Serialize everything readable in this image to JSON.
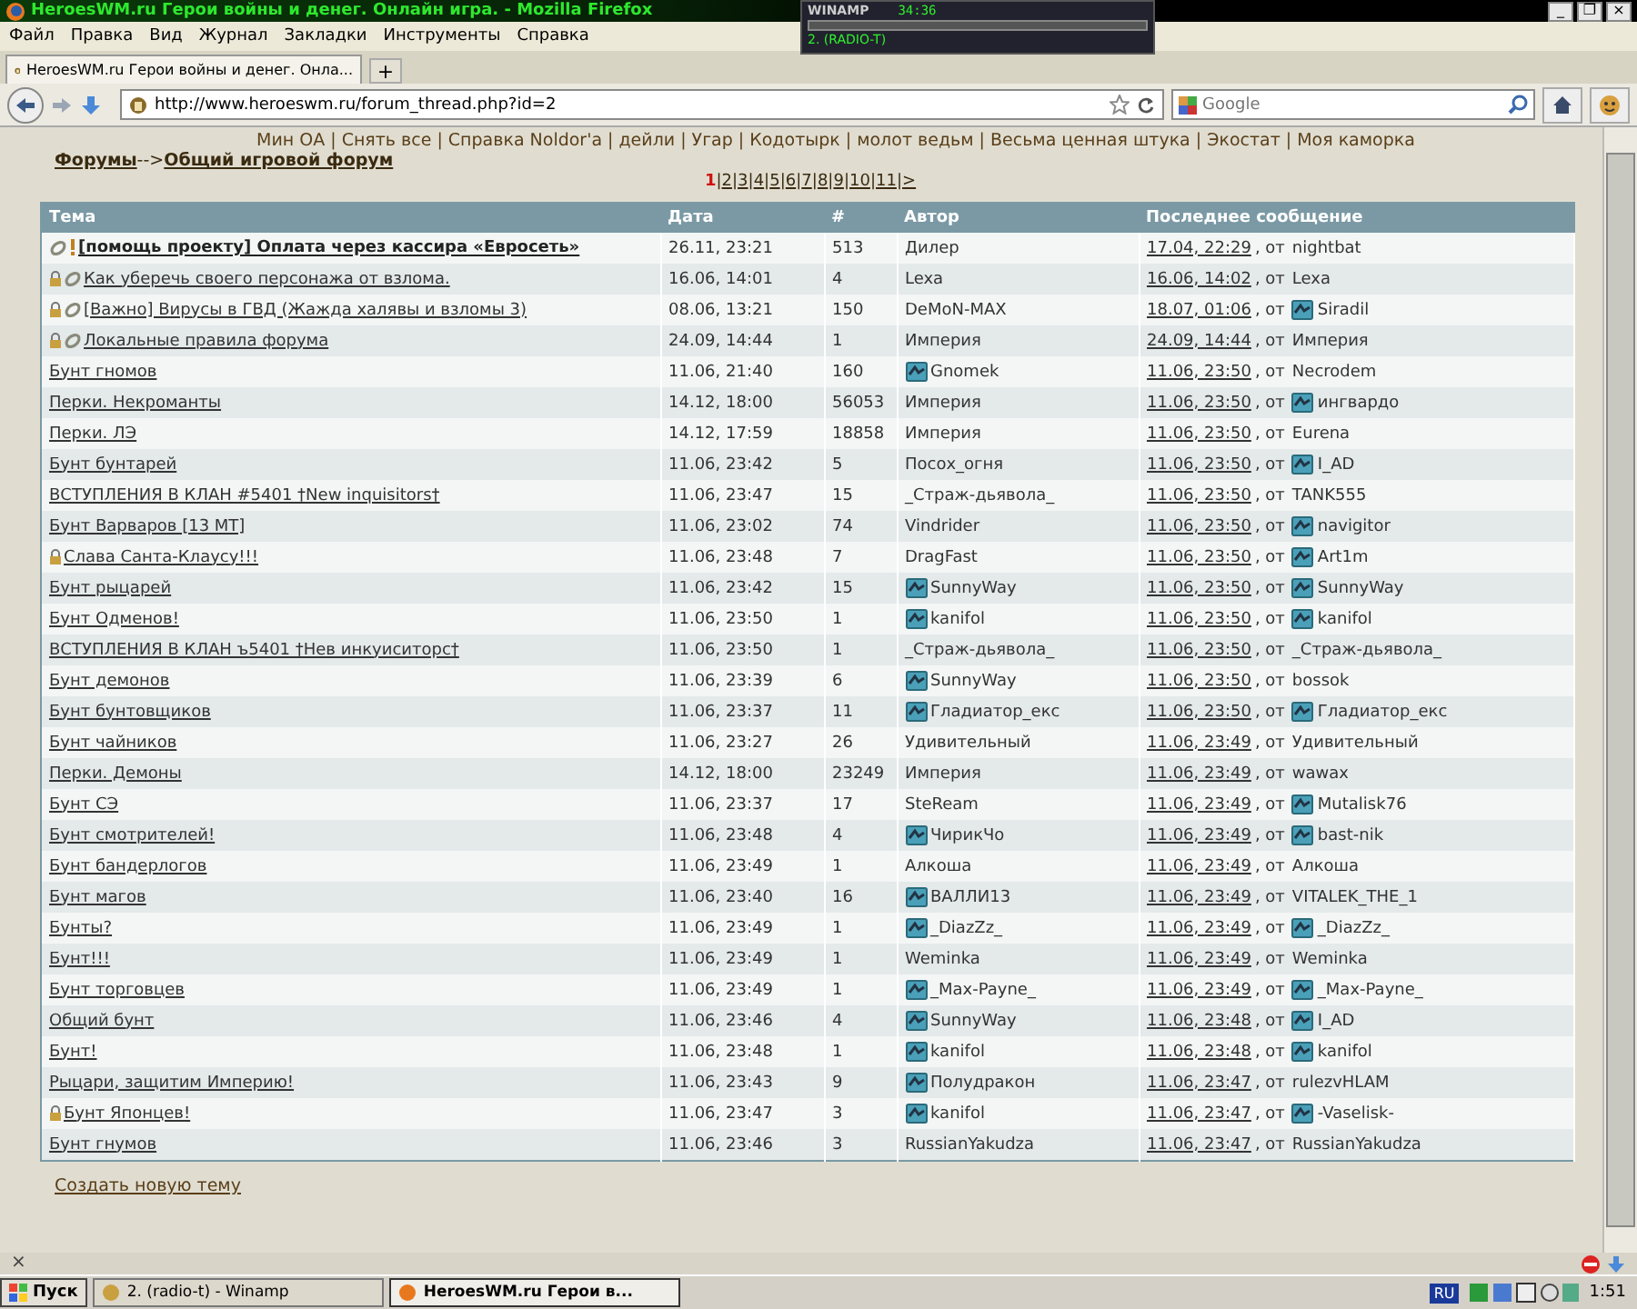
{
  "window": {
    "title": "HeroesWM.ru Герои войны и денег. Онлайн игра. - Mozilla Firefox",
    "controls": [
      "_",
      "❐",
      "×"
    ]
  },
  "winamp": {
    "title": "WINAMP",
    "time": "34:36",
    "track": "2. (RADIO-T)"
  },
  "menu": [
    "Файл",
    "Правка",
    "Вид",
    "Журнал",
    "Закладки",
    "Инструменты",
    "Справка"
  ],
  "tabs": [
    {
      "label": "HeroesWM.ru Герои войны и денег. Онла...",
      "selected": true
    }
  ],
  "new_tab": "+",
  "address": {
    "url": "http://www.heroeswm.ru/forum_thread.php?id=2"
  },
  "search": {
    "placeholder": "Google"
  },
  "top_links": [
    "Мин ОА",
    "Снять все",
    "Справка Noldor'a",
    "дейли",
    "Угар",
    "Кодотырк",
    "молот ведьм",
    "Весьма ценная штука",
    "Экостат",
    "Моя каморка"
  ],
  "link_separator": "|",
  "breadcrumb": {
    "root": "Форумы",
    "arrow": "-->",
    "current": "Общий игровой форум"
  },
  "pages": [
    {
      "label": "1",
      "selected": true
    },
    {
      "label": "2",
      "selected": false
    },
    {
      "label": "3",
      "selected": false
    },
    {
      "label": "4",
      "selected": false
    },
    {
      "label": "5",
      "selected": false
    },
    {
      "label": "6",
      "selected": false
    },
    {
      "label": "7",
      "selected": false
    },
    {
      "label": "8",
      "selected": false
    },
    {
      "label": "9",
      "selected": false
    },
    {
      "label": "10",
      "selected": false
    },
    {
      "label": "11",
      "selected": false
    },
    {
      "label": ">",
      "selected": false
    }
  ],
  "page_separator": "|",
  "table": {
    "columns": [
      "Тема",
      "Дата",
      "#",
      "Автор",
      "Последнее сообщение"
    ],
    "rows": [
      {
        "topic": "[помощь проекту] Оплата через кассира «Евросеть»",
        "locked": false,
        "pinned": true,
        "important": true,
        "date": "26.11, 23:21",
        "count": "513",
        "author": "Дилер",
        "author_emblem": false,
        "last_date": "17.04, 22:29",
        "by": ", от",
        "last_user": "nightbat",
        "last_emblem": false
      },
      {
        "topic": "Как уберечь своего персонажа от взлома.",
        "locked": true,
        "pinned": true,
        "important": false,
        "date": "16.06, 14:01",
        "count": "4",
        "author": "Lexa",
        "author_emblem": false,
        "last_date": "16.06, 14:02",
        "by": ", от",
        "last_user": "Lexa",
        "last_emblem": false
      },
      {
        "topic": "[Важно] Вирусы в ГВД (Жажда халявы и взломы 3)",
        "locked": true,
        "pinned": true,
        "important": false,
        "date": "08.06, 13:21",
        "count": "150",
        "author": "DeMoN-MAX",
        "author_emblem": false,
        "last_date": "18.07, 01:06",
        "by": ", от",
        "last_user": "Siradil",
        "last_emblem": true
      },
      {
        "topic": "Локальные правила форума",
        "locked": true,
        "pinned": true,
        "important": false,
        "date": "24.09, 14:44",
        "count": "1",
        "author": "Империя",
        "author_emblem": false,
        "last_date": "24.09, 14:44",
        "by": ", от",
        "last_user": "Империя",
        "last_emblem": false
      },
      {
        "topic": "Бунт гномов",
        "locked": false,
        "pinned": false,
        "important": false,
        "date": "11.06, 21:40",
        "count": "160",
        "author": "Gnomek",
        "author_emblem": true,
        "last_date": "11.06, 23:50",
        "by": ", от",
        "last_user": "Necrodem",
        "last_emblem": false
      },
      {
        "topic": "Перки. Некроманты",
        "locked": false,
        "pinned": false,
        "important": false,
        "date": "14.12, 18:00",
        "count": "56053",
        "author": "Империя",
        "author_emblem": false,
        "last_date": "11.06, 23:50",
        "by": ", от",
        "last_user": "ингвардо",
        "last_emblem": true
      },
      {
        "topic": "Перки. ЛЭ",
        "locked": false,
        "pinned": false,
        "important": false,
        "date": "14.12, 17:59",
        "count": "18858",
        "author": "Империя",
        "author_emblem": false,
        "last_date": "11.06, 23:50",
        "by": ", от",
        "last_user": "Eurena",
        "last_emblem": false
      },
      {
        "topic": "Бунт бунтарей",
        "locked": false,
        "pinned": false,
        "important": false,
        "date": "11.06, 23:42",
        "count": "5",
        "author": "Посох_огня",
        "author_emblem": false,
        "last_date": "11.06, 23:50",
        "by": ", от",
        "last_user": "I_AD",
        "last_emblem": true
      },
      {
        "topic": "ВСТУПЛЕНИЯ В КЛАН #5401 †New inquisitors†",
        "locked": false,
        "pinned": false,
        "important": false,
        "date": "11.06, 23:47",
        "count": "15",
        "author": "_Страж-дьявола_",
        "author_emblem": false,
        "last_date": "11.06, 23:50",
        "by": ", от",
        "last_user": "TANK555",
        "last_emblem": false
      },
      {
        "topic": "Бунт Варваров [13 МТ]",
        "locked": false,
        "pinned": false,
        "important": false,
        "date": "11.06, 23:02",
        "count": "74",
        "author": "Vindrider",
        "author_emblem": false,
        "last_date": "11.06, 23:50",
        "by": ", от",
        "last_user": "navigitor",
        "last_emblem": true
      },
      {
        "topic": "Слава Санта-Клаусу!!!",
        "locked": true,
        "pinned": false,
        "important": false,
        "date": "11.06, 23:48",
        "count": "7",
        "author": "DragFast",
        "author_emblem": false,
        "last_date": "11.06, 23:50",
        "by": ", от",
        "last_user": "Art1m",
        "last_emblem": true
      },
      {
        "topic": "Бунт рыцарей",
        "locked": false,
        "pinned": false,
        "important": false,
        "date": "11.06, 23:42",
        "count": "15",
        "author": "SunnyWay",
        "author_emblem": true,
        "last_date": "11.06, 23:50",
        "by": ", от",
        "last_user": "SunnyWay",
        "last_emblem": true
      },
      {
        "topic": "Бунт Одменов!",
        "locked": false,
        "pinned": false,
        "important": false,
        "date": "11.06, 23:50",
        "count": "1",
        "author": "kanifol",
        "author_emblem": true,
        "last_date": "11.06, 23:50",
        "by": ", от",
        "last_user": "kanifol",
        "last_emblem": true
      },
      {
        "topic": "ВСТУПЛЕНИЯ В КЛАН ъ5401 †Нев инкуиситорс†",
        "locked": false,
        "pinned": false,
        "important": false,
        "date": "11.06, 23:50",
        "count": "1",
        "author": "_Страж-дьявола_",
        "author_emblem": false,
        "last_date": "11.06, 23:50",
        "by": ", от",
        "last_user": "_Страж-дьявола_",
        "last_emblem": false
      },
      {
        "topic": "Бунт демонов",
        "locked": false,
        "pinned": false,
        "important": false,
        "date": "11.06, 23:39",
        "count": "6",
        "author": "SunnyWay",
        "author_emblem": true,
        "last_date": "11.06, 23:50",
        "by": ", от",
        "last_user": "bossok",
        "last_emblem": false
      },
      {
        "topic": "Бунт бунтовщиков",
        "locked": false,
        "pinned": false,
        "important": false,
        "date": "11.06, 23:37",
        "count": "11",
        "author": "Гладиатор_екс",
        "author_emblem": true,
        "last_date": "11.06, 23:50",
        "by": ", от",
        "last_user": "Гладиатор_екс",
        "last_emblem": true
      },
      {
        "topic": "Бунт чайников",
        "locked": false,
        "pinned": false,
        "important": false,
        "date": "11.06, 23:27",
        "count": "26",
        "author": "Удивительный",
        "author_emblem": false,
        "last_date": "11.06, 23:49",
        "by": ", от",
        "last_user": "Удивительный",
        "last_emblem": false
      },
      {
        "topic": "Перки. Демоны",
        "locked": false,
        "pinned": false,
        "important": false,
        "date": "14.12, 18:00",
        "count": "23249",
        "author": "Империя",
        "author_emblem": false,
        "last_date": "11.06, 23:49",
        "by": ", от",
        "last_user": "wawax",
        "last_emblem": false
      },
      {
        "topic": "Бунт СЭ",
        "locked": false,
        "pinned": false,
        "important": false,
        "date": "11.06, 23:37",
        "count": "17",
        "author": "SteReam",
        "author_emblem": false,
        "last_date": "11.06, 23:49",
        "by": ", от",
        "last_user": "Mutalisk76",
        "last_emblem": true
      },
      {
        "topic": "Бунт смотрителей!",
        "locked": false,
        "pinned": false,
        "important": false,
        "date": "11.06, 23:48",
        "count": "4",
        "author": "ЧирикЧо",
        "author_emblem": true,
        "last_date": "11.06, 23:49",
        "by": ", от",
        "last_user": "bast-nik",
        "last_emblem": true
      },
      {
        "topic": "Бунт бандерлогов",
        "locked": false,
        "pinned": false,
        "important": false,
        "date": "11.06, 23:49",
        "count": "1",
        "author": "Алкоша",
        "author_emblem": false,
        "last_date": "11.06, 23:49",
        "by": ", от",
        "last_user": "Алкоша",
        "last_emblem": false
      },
      {
        "topic": "Бунт магов",
        "locked": false,
        "pinned": false,
        "important": false,
        "date": "11.06, 23:40",
        "count": "16",
        "author": "ВАЛЛИ13",
        "author_emblem": true,
        "last_date": "11.06, 23:49",
        "by": ", от",
        "last_user": "VITALEK_THE_1",
        "last_emblem": false
      },
      {
        "topic": "Бунты?",
        "locked": false,
        "pinned": false,
        "important": false,
        "date": "11.06, 23:49",
        "count": "1",
        "author": "_DiazZz_",
        "author_emblem": true,
        "last_date": "11.06, 23:49",
        "by": ", от",
        "last_user": "_DiazZz_",
        "last_emblem": true
      },
      {
        "topic": "Бунт!!!",
        "locked": false,
        "pinned": false,
        "important": false,
        "date": "11.06, 23:49",
        "count": "1",
        "author": "Weminka",
        "author_emblem": false,
        "last_date": "11.06, 23:49",
        "by": ", от",
        "last_user": "Weminka",
        "last_emblem": false
      },
      {
        "topic": "Бунт торговцев",
        "locked": false,
        "pinned": false,
        "important": false,
        "date": "11.06, 23:49",
        "count": "1",
        "author": "_Max-Payne_",
        "author_emblem": true,
        "last_date": "11.06, 23:49",
        "by": ", от",
        "last_user": "_Max-Payne_",
        "last_emblem": true
      },
      {
        "topic": "Общий бунт",
        "locked": false,
        "pinned": false,
        "important": false,
        "date": "11.06, 23:46",
        "count": "4",
        "author": "SunnyWay",
        "author_emblem": true,
        "last_date": "11.06, 23:48",
        "by": ", от",
        "last_user": "I_AD",
        "last_emblem": true
      },
      {
        "topic": "Бунт!",
        "locked": false,
        "pinned": false,
        "important": false,
        "date": "11.06, 23:48",
        "count": "1",
        "author": "kanifol",
        "author_emblem": true,
        "last_date": "11.06, 23:48",
        "by": ", от",
        "last_user": "kanifol",
        "last_emblem": true
      },
      {
        "topic": "Рыцари, защитим Империю!",
        "locked": false,
        "pinned": false,
        "important": false,
        "date": "11.06, 23:43",
        "count": "9",
        "author": "Полудракон",
        "author_emblem": true,
        "last_date": "11.06, 23:47",
        "by": ", от",
        "last_user": "rulezvHLAM",
        "last_emblem": false
      },
      {
        "topic": "Бунт Японцев!",
        "locked": true,
        "pinned": false,
        "important": false,
        "date": "11.06, 23:47",
        "count": "3",
        "author": "kanifol",
        "author_emblem": true,
        "last_date": "11.06, 23:47",
        "by": ", от",
        "last_user": "-Vaselisk-",
        "last_emblem": true
      },
      {
        "topic": "Бунт гнумов",
        "locked": false,
        "pinned": false,
        "important": false,
        "date": "11.06, 23:46",
        "count": "3",
        "author": "RussianYakudza",
        "author_emblem": false,
        "last_date": "11.06, 23:47",
        "by": ", от",
        "last_user": "RussianYakudza",
        "last_emblem": false
      }
    ]
  },
  "create_topic": "Создать новую тему",
  "status_bar": {
    "close": "×"
  },
  "taskbar": {
    "start": "Пуск",
    "tasks": [
      {
        "label": "2. (radio-t) - Winamp",
        "selected": false
      },
      {
        "label": "HeroesWM.ru Герои в...",
        "selected": true
      }
    ],
    "language": "RU",
    "clock": "1:51"
  }
}
